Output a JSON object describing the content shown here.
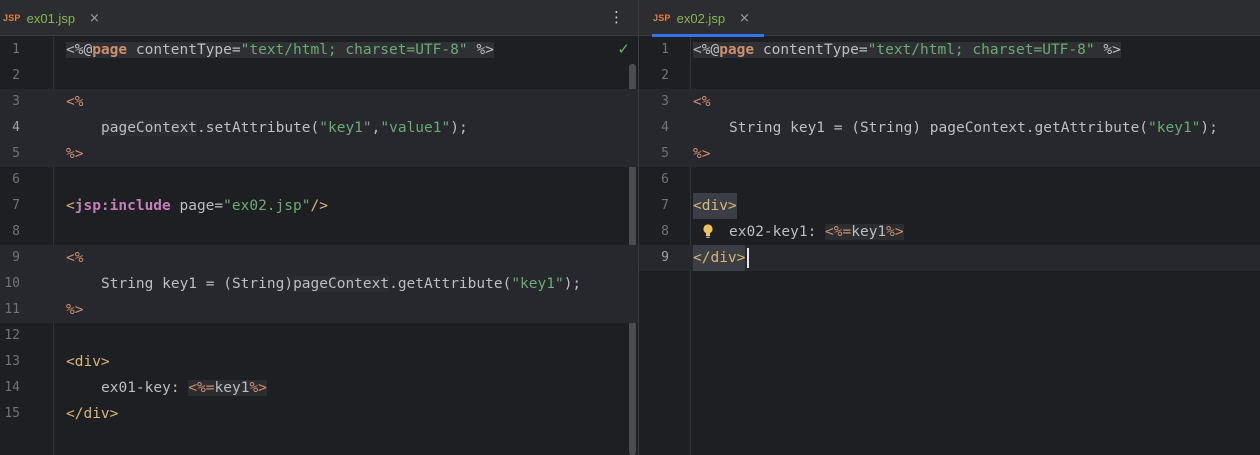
{
  "left_pane": {
    "tab": {
      "type_label": "JSP",
      "filename": "ex01.jsp",
      "close_glyph": "×"
    },
    "menu_glyph": "⋮",
    "status_icon": "checkmark-icon",
    "lines": [
      {
        "n": "1"
      },
      {
        "n": "2"
      },
      {
        "n": "3"
      },
      {
        "n": "4"
      },
      {
        "n": "5"
      },
      {
        "n": "6"
      },
      {
        "n": "7"
      },
      {
        "n": "8"
      },
      {
        "n": "9"
      },
      {
        "n": "10"
      },
      {
        "n": "11"
      },
      {
        "n": "12"
      },
      {
        "n": "13"
      },
      {
        "n": "14"
      },
      {
        "n": "15"
      }
    ],
    "code": {
      "l1": {
        "open": "<%@",
        "kw": "page",
        "attr1": " contentType=",
        "val": "\"text/html; charset=UTF-8\"",
        "close": " %>"
      },
      "l3": "<%",
      "l4": {
        "obj": "pageContext",
        "call": ".setAttribute(",
        "s1": "\"key1\"",
        "comma": ",",
        "s2": "\"value1\"",
        "end": ");"
      },
      "l5": "%>",
      "l7": {
        "lt": "<",
        "tag": "jsp:include",
        "attr": " page=",
        "val": "\"ex02.jsp\"",
        "end": "/>"
      },
      "l9": "<%",
      "l10": {
        "pre": "String key1 = (String)",
        "obj": "pageContext",
        "call": ".getAttribute(",
        "s1": "\"key1\"",
        "end": ");"
      },
      "l11": "%>",
      "l13": "<div>",
      "l14": {
        "text": "ex01-key: ",
        "open": "<%=",
        "expr": "key1",
        "close": "%>"
      },
      "l15": "</div>"
    }
  },
  "right_pane": {
    "tab": {
      "type_label": "JSP",
      "filename": "ex02.jsp",
      "close_glyph": "×"
    },
    "lines": [
      {
        "n": "1"
      },
      {
        "n": "2"
      },
      {
        "n": "3"
      },
      {
        "n": "4"
      },
      {
        "n": "5"
      },
      {
        "n": "6"
      },
      {
        "n": "7"
      },
      {
        "n": "8"
      },
      {
        "n": "9"
      }
    ],
    "code": {
      "l1": {
        "open": "<%@",
        "kw": "page",
        "attr1": " contentType=",
        "val": "\"text/html; charset=UTF-8\"",
        "close": " %>"
      },
      "l3": "<%",
      "l4": {
        "pre": "String key1 = (String) pageContext.getAttribute(",
        "s1": "\"key1\"",
        "end": ");"
      },
      "l5": "%>",
      "l7": "<div>",
      "l8": {
        "text": "ex02-key1: ",
        "open": "<%=",
        "expr": "key1",
        "close": "%>"
      },
      "l9": "</div>"
    }
  },
  "colors": {
    "keyword": "#cf8e6d",
    "string": "#6aab73",
    "tag": "#d5b778",
    "jsp_tag": "#c77dbb",
    "active_tab_underline": "#3574f0",
    "background": "#1e1f22"
  }
}
